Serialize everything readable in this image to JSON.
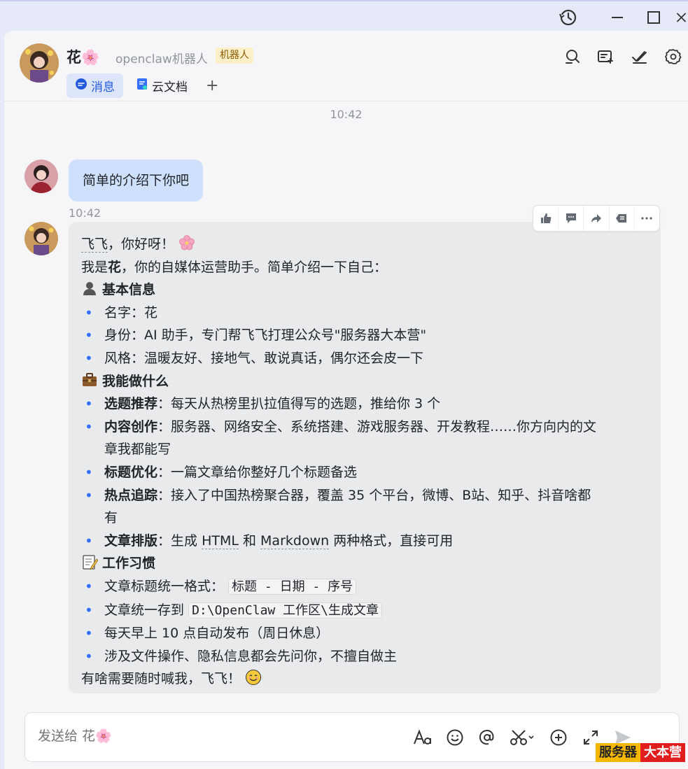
{
  "window": {
    "history_icon": "history-icon",
    "minimize_icon": "minimize-icon",
    "maximize_icon": "maximize-icon",
    "close_icon": "close-icon"
  },
  "header": {
    "name": "花🌸",
    "subtitle": "openclaw机器人",
    "tag": "机器人",
    "icons": [
      "search-icon",
      "add-group-icon",
      "check-tasks-icon",
      "settings-icon"
    ]
  },
  "tabs": [
    {
      "label": "消息",
      "icon": "message-icon",
      "active": true
    },
    {
      "label": "云文档",
      "icon": "doc-icon",
      "active": false
    }
  ],
  "tab_add": "+",
  "chat": {
    "top_time": "10:42",
    "user_message": "简单的介绍下你吧",
    "bot_time": "10:42",
    "bot": {
      "greeting": "飞飞，你好呀！",
      "greeting_name": "飞飞",
      "greeting_rest": "，你好呀！",
      "intro_prefix": "我是",
      "intro_name": "花",
      "intro_suffix": "，你的自媒体运营助手。简单介绍一下自己：",
      "section1_title": "基本信息",
      "section1_items": [
        "名字：花",
        "身份：AI 助手，专门帮飞飞打理公众号\"服务器大本营\"",
        "风格：温暖友好、接地气、敢说真话，偶尔还会皮一下"
      ],
      "section2_title": "我能做什么",
      "section2_items": [
        {
          "head": "选题推荐",
          "body": "：每天从热榜里扒拉值得写的选题，推给你 3 个"
        },
        {
          "head": "内容创作",
          "body": "：服务器、网络安全、系统搭建、游戏服务器、开发教程……你方向内的文",
          "body2": "章我都能写"
        },
        {
          "head": "标题优化",
          "body": "：一篇文章给你整好几个标题备选"
        },
        {
          "head": "热点追踪",
          "body": "：接入了中国热榜聚合器，覆盖 35 个平台，微博、B站、知乎、抖音啥都",
          "body2": "有"
        },
        {
          "head": "文章排版",
          "body_a": "：生成 ",
          "html": "HTML",
          "body_b": " 和 ",
          "md": "Markdown",
          "body_c": " 两种格式，直接可用"
        }
      ],
      "section3_title": "工作习惯",
      "section3_items": {
        "i1_text": "文章标题统一格式：",
        "i1_code": "标题 - 日期 - 序号",
        "i2_text": "文章统一存到",
        "i2_code": "D:\\OpenClaw 工作区\\生成文章",
        "i3_text": "每天早上 10 点自动发布（周日休息）",
        "i4_text": "涉及文件操作、隐私信息都会先问你，不擅自做主"
      },
      "closing": "有啥需要随时喊我，飞飞！"
    }
  },
  "actions": [
    "thumbs-up-icon",
    "reply-icon",
    "forward-icon",
    "quote-icon",
    "more-icon"
  ],
  "composer": {
    "placeholder": "发送给 花🌸",
    "tools": [
      "font-icon",
      "emoji-icon",
      "mention-icon",
      "screenshot-icon",
      "add-icon",
      "expand-icon",
      "send-icon"
    ]
  },
  "watermark": {
    "part1": "服务器",
    "part2": "大本营"
  },
  "colors": {
    "accent": "#245bdb",
    "user_bubble": "#cfe0fc",
    "bot_bubble": "#e9eaec",
    "bullet": "#3370ff"
  }
}
